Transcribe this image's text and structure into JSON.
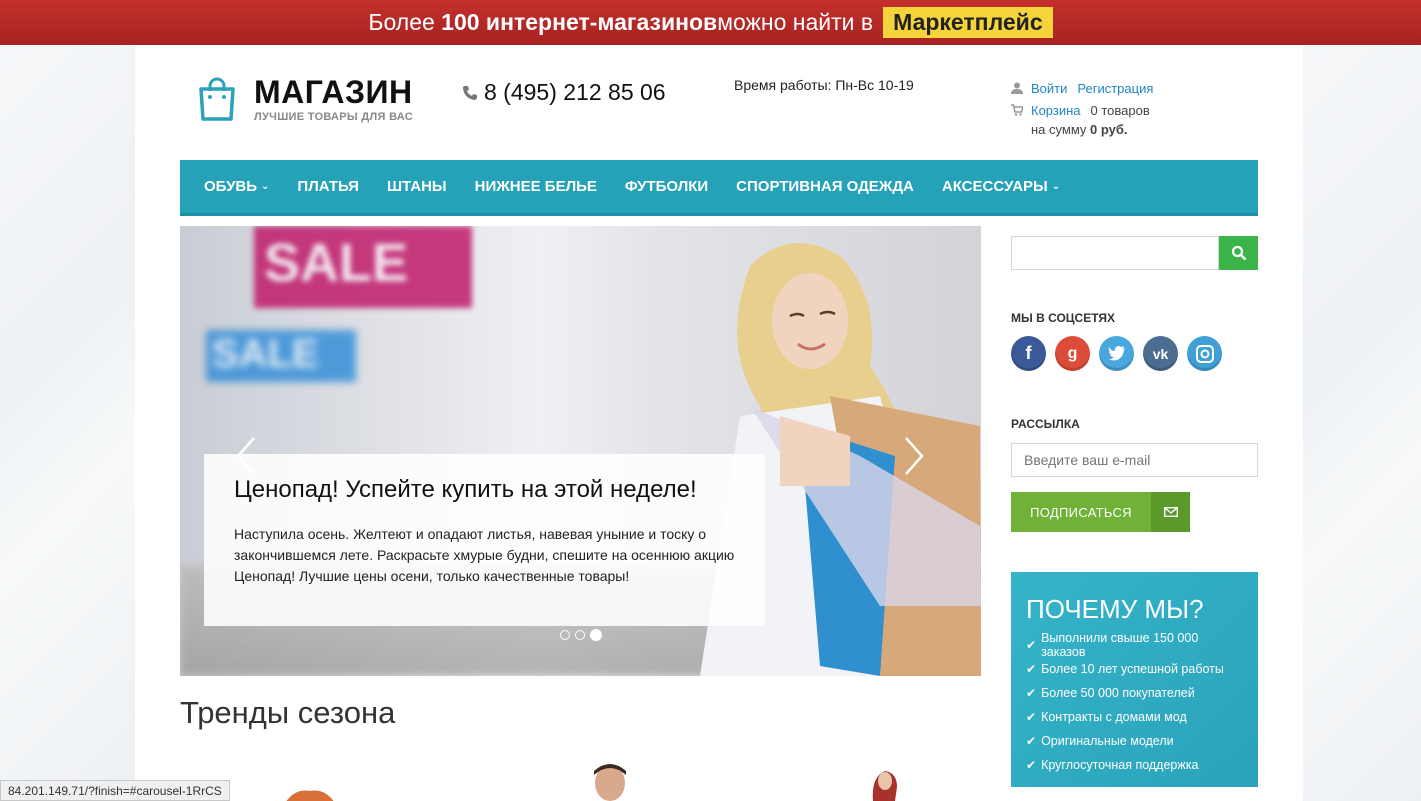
{
  "banner": {
    "prefix": "Более ",
    "bold": "100 интернет-магазинов",
    "suffix": " можно найти в",
    "marketplace": "Маркетплейс"
  },
  "header": {
    "logo_title": "МАГАЗИН",
    "logo_sub": "ЛУЧШИЕ ТОВАРЫ ДЛЯ ВАС",
    "phone": "8 (495) 212 85 06",
    "hours": "Время работы: Пн-Вс 10-19",
    "login": "Войти",
    "register": "Регистрация",
    "cart": "Корзина",
    "cart_count": "0 товаров",
    "sum_label": "на сумму ",
    "sum_value": "0 руб."
  },
  "nav": {
    "items": [
      {
        "label": "ОБУВЬ",
        "dropdown": true
      },
      {
        "label": "ПЛАТЬЯ",
        "dropdown": false
      },
      {
        "label": "ШТАНЫ",
        "dropdown": false
      },
      {
        "label": "НИЖНЕЕ БЕЛЬЕ",
        "dropdown": false
      },
      {
        "label": "ФУТБОЛКИ",
        "dropdown": false
      },
      {
        "label": "СПОРТИВНАЯ ОДЕЖДА",
        "dropdown": false
      },
      {
        "label": "АКСЕССУАРЫ",
        "dropdown": true
      }
    ]
  },
  "hero": {
    "sale_text_1": "SALE",
    "sale_text_2": "SALE",
    "title": "Ценопад! Успейте купить на этой неделе!",
    "text": "Наступила осень. Желтеют и опадают листья, навевая уныние и тоску о закончившемся лете. Раскрасьте хмурые будни, спешите на осеннюю акцию Ценопад! Лучшие цены осени, только качественные товары!",
    "slides": 3,
    "active_slide": 3
  },
  "trends": {
    "title": "Тренды сезона"
  },
  "sidebar": {
    "search_placeholder": "",
    "social_title": "МЫ В СОЦСЕТЯХ",
    "socials": [
      "facebook-icon",
      "google-plus-icon",
      "twitter-icon",
      "vk-icon",
      "instagram-icon"
    ],
    "newsletter_title": "РАССЫЛКА",
    "email_placeholder": "Введите ваш e-mail",
    "subscribe_label": "ПОДПИСАТЬСЯ",
    "why_title": "ПОЧЕМУ МЫ?",
    "why_items": [
      "Выполнили свыше 150 000 заказов",
      "Более 10 лет успешной работы",
      "Более 50 000 покупателей",
      "Контракты с домами мод",
      "Оригинальные модели",
      "Круглосуточная поддержка"
    ]
  },
  "status_bar": "84.201.149.71/?finish=#carousel-1RrCS",
  "colors": {
    "nav": "#25a1b8",
    "banner": "#b52a27",
    "marketplace": "#f5d33b",
    "search_btn": "#3bb54a",
    "subscribe": "#6fb237",
    "why_bg": "#2fabc1"
  }
}
